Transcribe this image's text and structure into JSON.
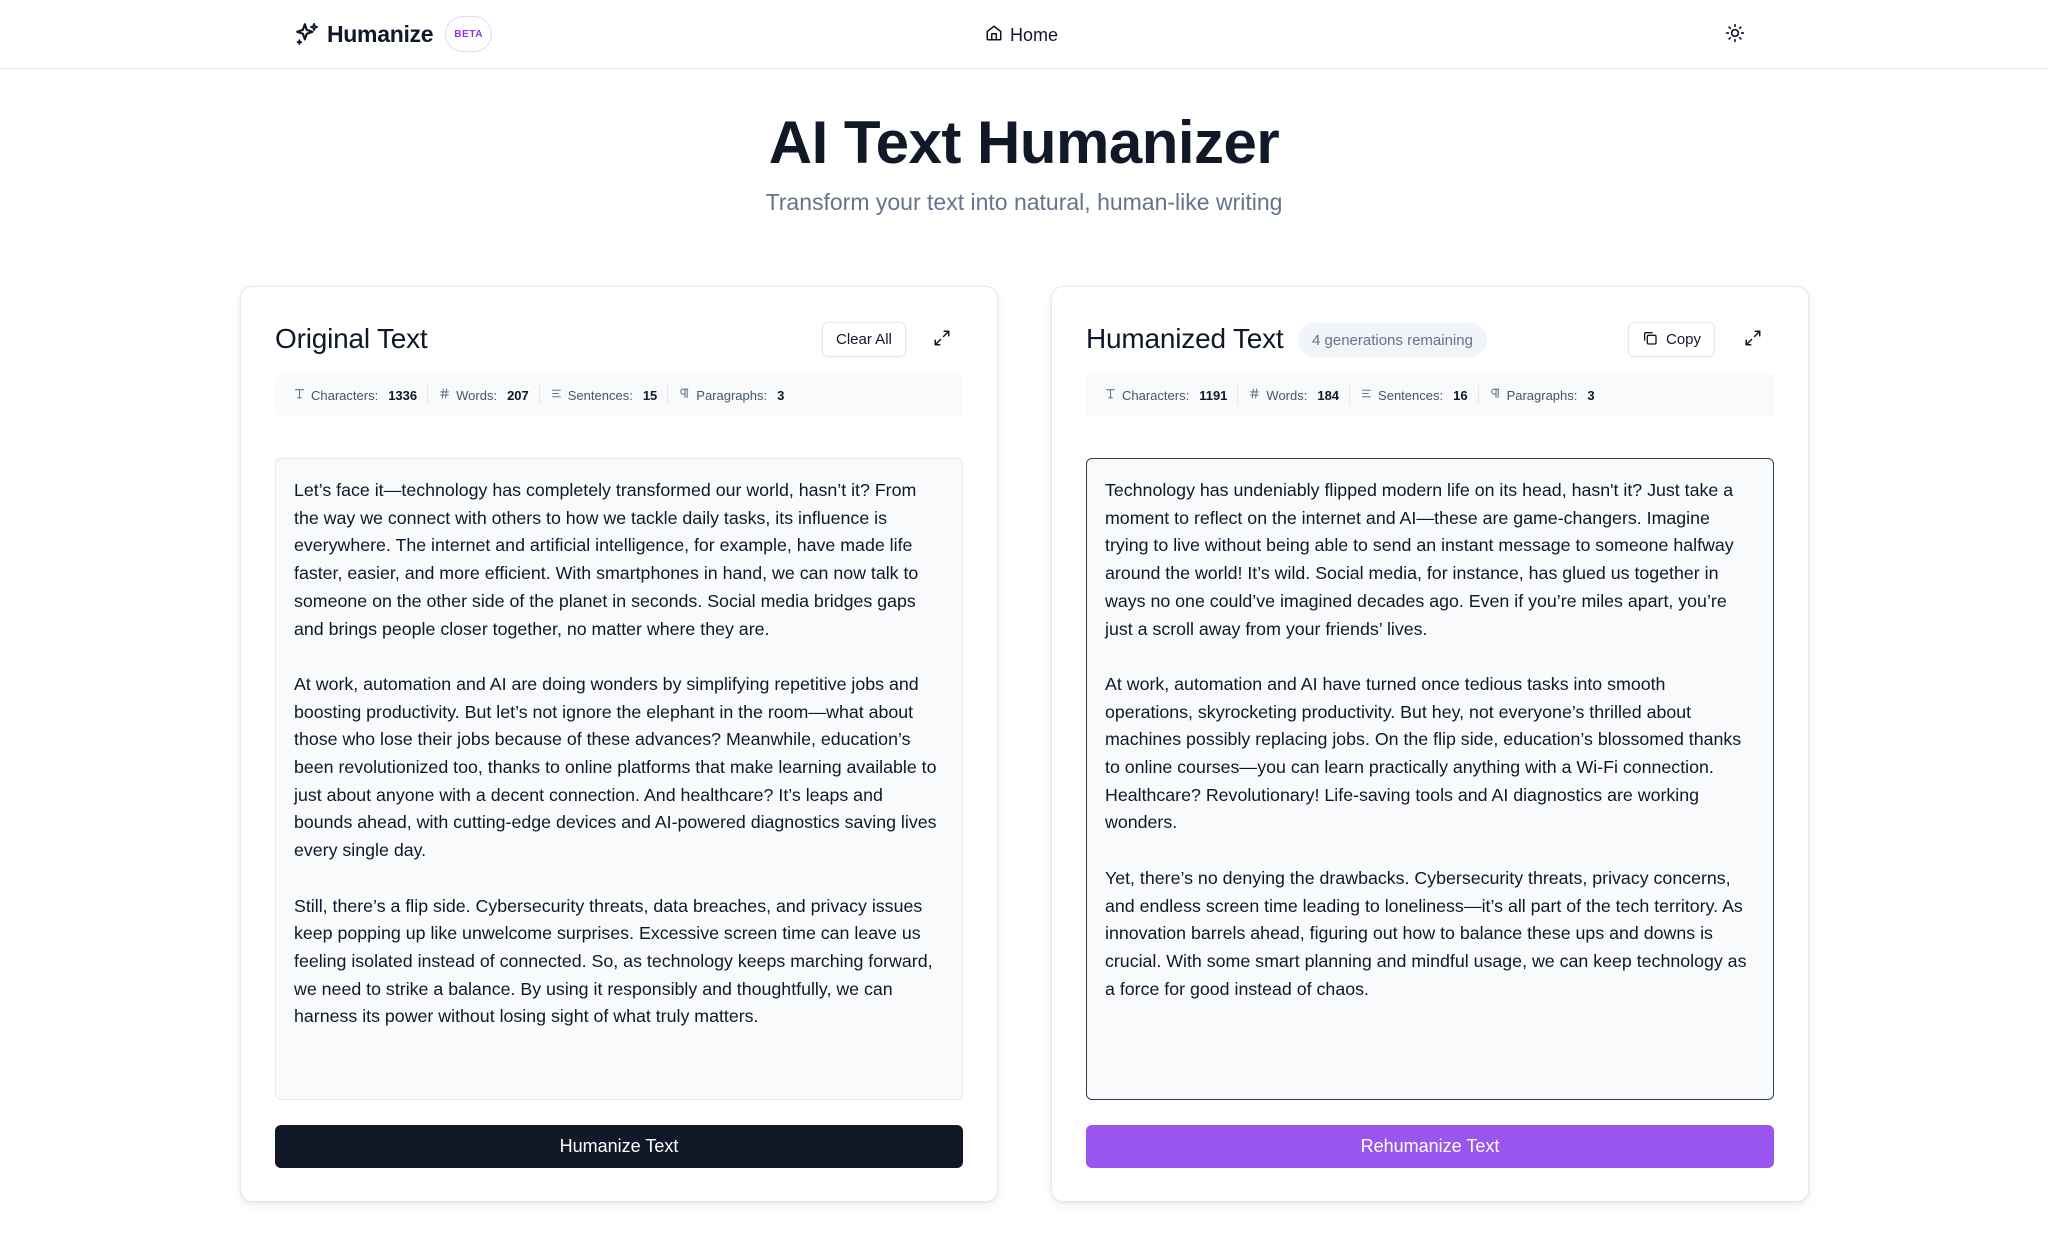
{
  "header": {
    "brand_name": "Humanize",
    "beta_label": "BETA",
    "nav_home": "Home"
  },
  "hero": {
    "title": "AI Text Humanizer",
    "subtitle": "Transform your text into natural, human-like writing"
  },
  "original": {
    "title": "Original Text",
    "clear_label": "Clear All",
    "stats": {
      "characters_label": "Characters:",
      "characters": "1336",
      "words_label": "Words:",
      "words": "207",
      "sentences_label": "Sentences:",
      "sentences": "15",
      "paragraphs_label": "Paragraphs:",
      "paragraphs": "3"
    },
    "paragraphs": [
      "Let’s face it—technology has completely transformed our world, hasn’t it? From the way we connect with others to how we tackle daily tasks, its influence is everywhere. The internet and artificial intelligence, for example, have made life faster, easier, and more efficient. With smartphones in hand, we can now talk to someone on the other side of the planet in seconds. Social media bridges gaps and brings people closer together, no matter where they are.",
      "At work, automation and AI are doing wonders by simplifying repetitive jobs and boosting productivity. But let’s not ignore the elephant in the room—what about those who lose their jobs because of these advances? Meanwhile, education’s been revolutionized too, thanks to online platforms that make learning available to just about anyone with a decent connection. And healthcare? It’s leaps and bounds ahead, with cutting-edge devices and AI-powered diagnostics saving lives every single day.",
      "Still, there’s a flip side. Cybersecurity threats, data breaches, and privacy issues keep popping up like unwelcome surprises. Excessive screen time can leave us feeling isolated instead of connected. So, as technology keeps marching forward, we need to strike a balance. By using it responsibly and thoughtfully, we can harness its power without losing sight of what truly matters."
    ],
    "action_label": "Humanize Text"
  },
  "humanized": {
    "title": "Humanized Text",
    "badge": "4 generations remaining",
    "copy_label": "Copy",
    "stats": {
      "characters_label": "Characters:",
      "characters": "1191",
      "words_label": "Words:",
      "words": "184",
      "sentences_label": "Sentences:",
      "sentences": "16",
      "paragraphs_label": "Paragraphs:",
      "paragraphs": "3"
    },
    "paragraphs": [
      "Technology has undeniably flipped modern life on its head, hasn't it? Just take a moment to reflect on the internet and AI—these are game-changers. Imagine trying to live without being able to send an instant message to someone halfway around the world! It’s wild. Social media, for instance, has glued us together in ways no one could’ve imagined decades ago. Even if you’re miles apart, you’re just a scroll away from your friends’ lives.",
      "At work, automation and AI have turned once tedious tasks into smooth operations, skyrocketing productivity. But hey, not everyone’s thrilled about machines possibly replacing jobs. On the flip side, education’s blossomed thanks to online courses—you can learn practically anything with a Wi-Fi connection. Healthcare? Revolutionary! Life-saving tools and AI diagnostics are working wonders.",
      "Yet, there’s no denying the drawbacks. Cybersecurity threats, privacy concerns, and endless screen time leading to loneliness—it’s all part of the tech territory. As innovation barrels ahead, figuring out how to balance these ups and downs is crucial. With some smart planning and mindful usage, we can keep technology as a force for good instead of chaos."
    ],
    "action_label": "Rehumanize Text"
  },
  "colors": {
    "primary_dark": "#111827",
    "accent_purple": "#9955ee",
    "beta_purple": "#9333ea"
  },
  "icons": [
    "sparkles-icon",
    "home-icon",
    "sun-icon",
    "expand-icon",
    "copy-icon",
    "text-type-icon",
    "hash-icon",
    "align-left-icon",
    "pilcrow-icon"
  ]
}
